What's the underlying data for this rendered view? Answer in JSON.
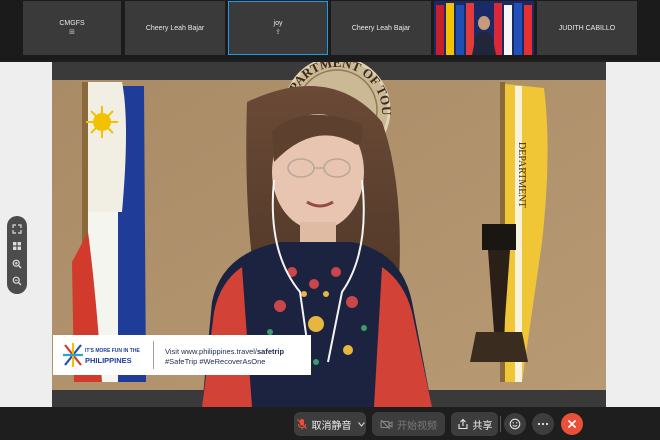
{
  "participants": [
    {
      "name": "CMGFS",
      "sub": "⊞"
    },
    {
      "name": "Cheery Leah Bajar",
      "sub": ""
    },
    {
      "name": "joy",
      "sub": "⇪",
      "active": true
    },
    {
      "name": "Cheery Leah Bajar",
      "sub": ""
    },
    {
      "name": "",
      "sub": "",
      "video": true
    },
    {
      "name": "JUDITH CABILLO",
      "sub": ""
    }
  ],
  "banner": {
    "logo_top": "IT'S MORE FUN IN THE",
    "logo_main": "PHILIPPINES",
    "visit_prefix": "Visit www.philippines.travel/",
    "visit_bold": "safetrip",
    "hashtags": "#SafeTrip  #WeRecoverAsOne"
  },
  "backdrop": {
    "seal_text": "DEPARTMENT OF TOURISM",
    "flag_text": "DEPARTMENT"
  },
  "toolbar": {
    "unmute_label": "取消静音",
    "video_label": "开始视频",
    "share_label": "共享"
  },
  "colors": {
    "accent": "#1e9be8",
    "end_button": "#e8503a",
    "tile_bg": "#3a3a3a"
  },
  "icons": {
    "zoom": [
      "fit-icon",
      "grid-icon",
      "zoom-in-icon",
      "zoom-out-icon"
    ],
    "toolbar": [
      "mic-off-icon",
      "chevron-down-icon",
      "camera-off-icon",
      "share-icon",
      "emoji-icon",
      "more-icon",
      "close-icon"
    ]
  }
}
